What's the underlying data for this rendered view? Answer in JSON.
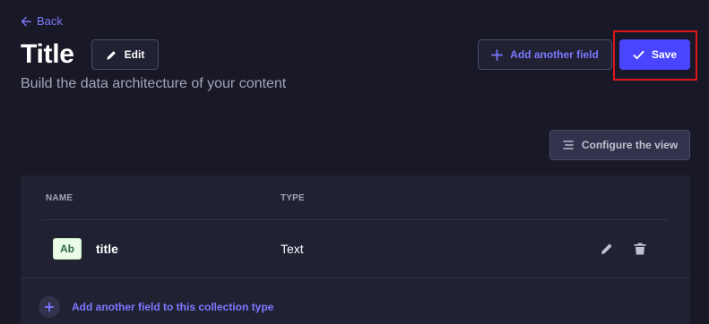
{
  "header": {
    "back_label": "Back",
    "title": "Title",
    "edit_label": "Edit",
    "subtitle": "Build the data architecture of your content",
    "add_field_label": "Add another field",
    "save_label": "Save",
    "configure_label": "Configure the view"
  },
  "table": {
    "columns": [
      "NAME",
      "TYPE"
    ],
    "rows": [
      {
        "badge": "Ab",
        "name": "title",
        "type": "Text"
      }
    ],
    "add_field_to_collection_label": "Add another field to this collection type"
  },
  "icons": {
    "back": "arrow-left-icon",
    "edit": "pencil-icon",
    "add": "plus-icon",
    "save": "check-icon",
    "configure": "list-icon",
    "row_edit": "pencil-icon",
    "row_delete": "trash-icon"
  },
  "colors": {
    "background": "#181826",
    "card": "#212134",
    "accent": "#4945ff",
    "link": "#7b79ff",
    "highlight": "#e0161a"
  }
}
